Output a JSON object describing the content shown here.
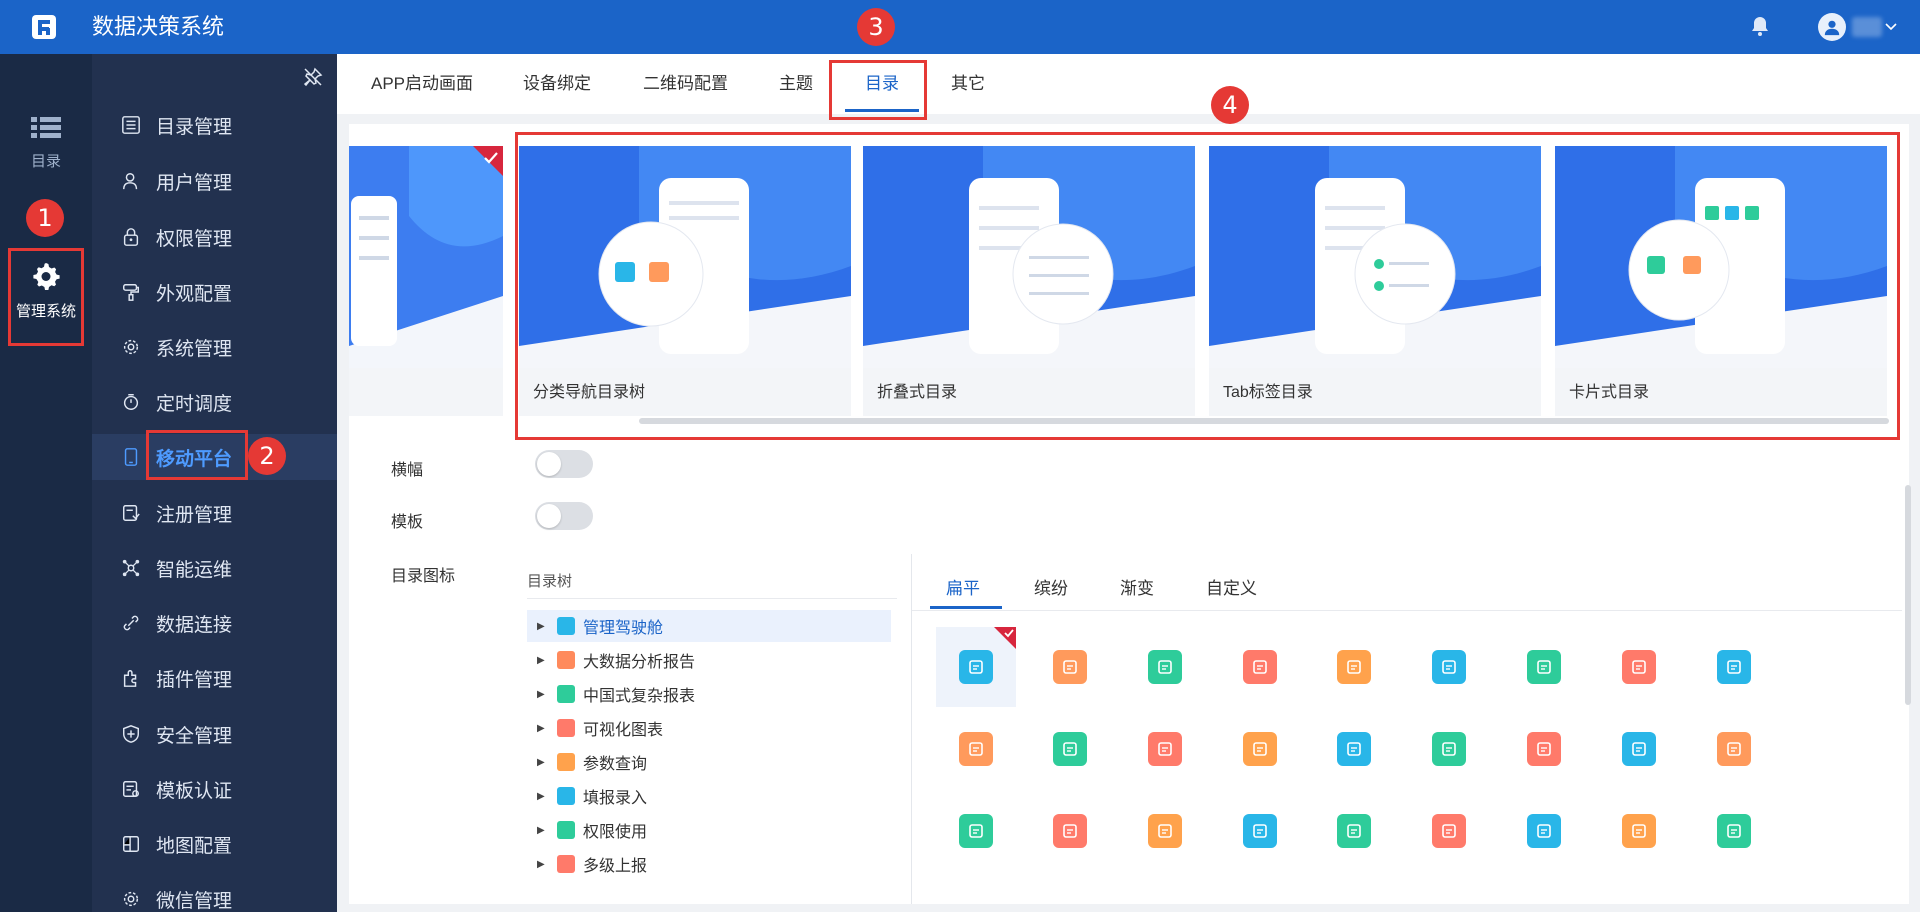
{
  "app": {
    "title": "数据决策系统"
  },
  "rail": {
    "items": [
      {
        "label": "目录",
        "icon": "list-icon"
      },
      {
        "label": "管理系统",
        "icon": "gear-icon"
      }
    ]
  },
  "sidebar": {
    "items": [
      {
        "label": "目录管理",
        "icon": "catalog-icon"
      },
      {
        "label": "用户管理",
        "icon": "user-icon"
      },
      {
        "label": "权限管理",
        "icon": "lock-icon"
      },
      {
        "label": "外观配置",
        "icon": "brush-icon"
      },
      {
        "label": "系统管理",
        "icon": "settings-icon"
      },
      {
        "label": "定时调度",
        "icon": "timer-icon"
      },
      {
        "label": "移动平台",
        "icon": "mobile-icon",
        "active": true
      },
      {
        "label": "注册管理",
        "icon": "register-icon"
      },
      {
        "label": "智能运维",
        "icon": "ops-icon"
      },
      {
        "label": "数据连接",
        "icon": "link-icon"
      },
      {
        "label": "插件管理",
        "icon": "plugin-icon"
      },
      {
        "label": "安全管理",
        "icon": "shield-icon"
      },
      {
        "label": "模板认证",
        "icon": "template-icon"
      },
      {
        "label": "地图配置",
        "icon": "map-icon"
      },
      {
        "label": "微信管理",
        "icon": "wechat-icon"
      }
    ]
  },
  "tabs": [
    {
      "label": "APP启动画面"
    },
    {
      "label": "设备绑定"
    },
    {
      "label": "二维码配置"
    },
    {
      "label": "主题"
    },
    {
      "label": "目录",
      "active": true
    },
    {
      "label": "其它"
    }
  ],
  "cards": [
    {
      "label": "分类导航目录树"
    },
    {
      "label": "折叠式目录"
    },
    {
      "label": "Tab标签目录"
    },
    {
      "label": "卡片式目录"
    }
  ],
  "form": {
    "banner_label": "横幅",
    "template_label": "模板",
    "catalog_icon_label": "目录图标",
    "banner_on": false,
    "template_on": false
  },
  "tree": {
    "header": "目录树",
    "items": [
      {
        "label": "管理驾驶舱",
        "color": "#29b6e8",
        "active": true
      },
      {
        "label": "大数据分析报告",
        "color": "#ff8a5c"
      },
      {
        "label": "中国式复杂报表",
        "color": "#2ecc9a"
      },
      {
        "label": "可视化图表",
        "color": "#ff7a6a"
      },
      {
        "label": "参数查询",
        "color": "#ffa24c"
      },
      {
        "label": "填报录入",
        "color": "#29b6e8"
      },
      {
        "label": "权限使用",
        "color": "#2ecc9a"
      },
      {
        "label": "多级上报",
        "color": "#ff7a6a"
      }
    ]
  },
  "icon_tabs": [
    {
      "label": "扁平",
      "active": true
    },
    {
      "label": "缤纷"
    },
    {
      "label": "渐变"
    },
    {
      "label": "自定义"
    }
  ],
  "icon_colors": [
    "#29b6e8",
    "#ff9a5c",
    "#2ecc9a",
    "#ff7a6a",
    "#ffa24c",
    "#29b6e8",
    "#2ecc9a",
    "#ff7a6a",
    "#29b6e8",
    "#ff9a5c",
    "#2ecc9a",
    "#ff7a6a",
    "#ffa24c",
    "#29b6e8",
    "#2ecc9a",
    "#ff7a6a",
    "#29b6e8",
    "#ff9a5c",
    "#2ecc9a",
    "#ff7a6a",
    "#ffa24c",
    "#29b6e8",
    "#2ecc9a",
    "#ff7a6a",
    "#29b6e8",
    "#ffa24c",
    "#2ecc9a"
  ],
  "annotations": [
    "1",
    "2",
    "3",
    "4"
  ],
  "colors": {
    "accent": "#1b64c8",
    "highlight": "#e53935"
  }
}
